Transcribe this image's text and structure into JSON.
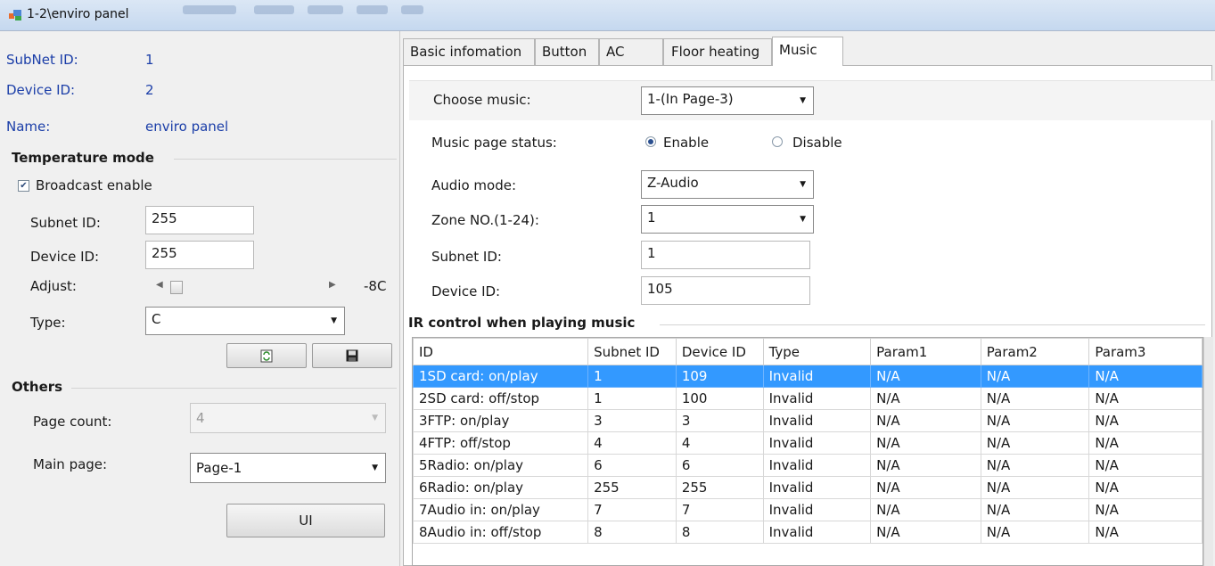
{
  "window": {
    "title": "1-2\\enviro panel"
  },
  "left": {
    "subnet_id_label": "SubNet ID:",
    "subnet_id_value": "1",
    "device_id_label": "Device ID:",
    "device_id_value": "2",
    "name_label": "Name:",
    "name_value": "enviro panel",
    "temperature_mode": {
      "title": "Temperature mode",
      "broadcast_label": "Broadcast enable",
      "broadcast_checked": true,
      "subnet_id_label": "Subnet ID:",
      "subnet_id_value": "255",
      "device_id_label": "Device ID:",
      "device_id_value": "255",
      "adjust_label": "Adjust:",
      "adjust_value": "-8C",
      "type_label": "Type:",
      "type_value": "C"
    },
    "others": {
      "title": "Others",
      "page_count_label": "Page count:",
      "page_count_value": "4",
      "main_page_label": "Main page:",
      "main_page_value": "Page-1",
      "ui_button": "UI"
    }
  },
  "tabs": [
    {
      "label": "Basic infomation"
    },
    {
      "label": "Button"
    },
    {
      "label": "AC"
    },
    {
      "label": "Floor heating"
    },
    {
      "label": "Music",
      "active": true
    }
  ],
  "music": {
    "choose_label": "Choose music:",
    "choose_value": "1-(In Page-3)",
    "status_label": "Music page status:",
    "enable_label": "Enable",
    "disable_label": "Disable",
    "enabled": true,
    "audio_mode_label": "Audio mode:",
    "audio_mode_value": "Z-Audio",
    "zone_label": "Zone NO.(1-24):",
    "zone_value": "1",
    "subnet_id_label": "Subnet ID:",
    "subnet_id_value": "1",
    "device_id_label": "Device ID:",
    "device_id_value": "105",
    "ir_title": "IR control when playing music"
  },
  "ir_table": {
    "columns": [
      "ID",
      "Subnet ID",
      "Device ID",
      "Type",
      "Param1",
      "Param2",
      "Param3"
    ],
    "rows": [
      [
        "1SD card: on/play",
        "1",
        "109",
        "Invalid",
        "N/A",
        "N/A",
        "N/A"
      ],
      [
        "2SD card: off/stop",
        "1",
        "100",
        "Invalid",
        "N/A",
        "N/A",
        "N/A"
      ],
      [
        "3FTP: on/play",
        "3",
        "3",
        "Invalid",
        "N/A",
        "N/A",
        "N/A"
      ],
      [
        "4FTP: off/stop",
        "4",
        "4",
        "Invalid",
        "N/A",
        "N/A",
        "N/A"
      ],
      [
        "5Radio: on/play",
        "6",
        "6",
        "Invalid",
        "N/A",
        "N/A",
        "N/A"
      ],
      [
        "6Radio: on/play",
        "255",
        "255",
        "Invalid",
        "N/A",
        "N/A",
        "N/A"
      ],
      [
        "7Audio in: on/play",
        "7",
        "7",
        "Invalid",
        "N/A",
        "N/A",
        "N/A"
      ],
      [
        "8Audio in: off/stop",
        "8",
        "8",
        "Invalid",
        "N/A",
        "N/A",
        "N/A"
      ]
    ],
    "selected_row": 0
  },
  "colors": {
    "selection": "#3399ff",
    "label_blue": "#1b3ea8"
  }
}
